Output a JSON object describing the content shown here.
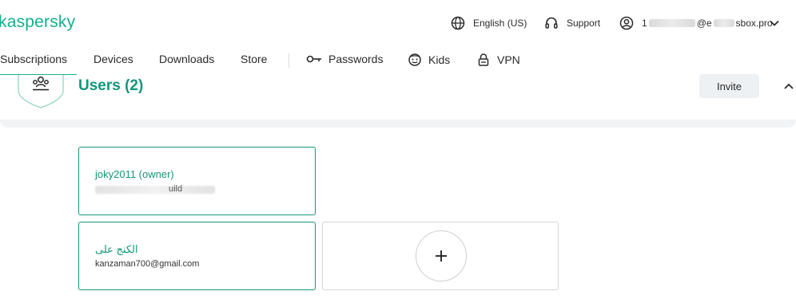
{
  "header": {
    "logo": "kaspersky",
    "language": "English (US)",
    "support": "Support",
    "account_prefix": "1",
    "account_suffix": "@e",
    "account_domain": "sbox.pro"
  },
  "nav": {
    "items": [
      {
        "label": "Subscriptions"
      },
      {
        "label": "Devices"
      },
      {
        "label": "Downloads"
      },
      {
        "label": "Store"
      },
      {
        "label": "Passwords"
      },
      {
        "label": "Kids"
      },
      {
        "label": "VPN"
      }
    ]
  },
  "users_section": {
    "title": "Users (2)",
    "invite_label": "Invite"
  },
  "users": [
    {
      "name": "joky2011 (owner)",
      "email": "uild"
    },
    {
      "name": "الكنج على",
      "email": "kanzaman700@gmail.com"
    }
  ],
  "colors": {
    "brand": "#13b08e",
    "brand_dark": "#13977a",
    "muted_bg": "#f2f3f4"
  }
}
